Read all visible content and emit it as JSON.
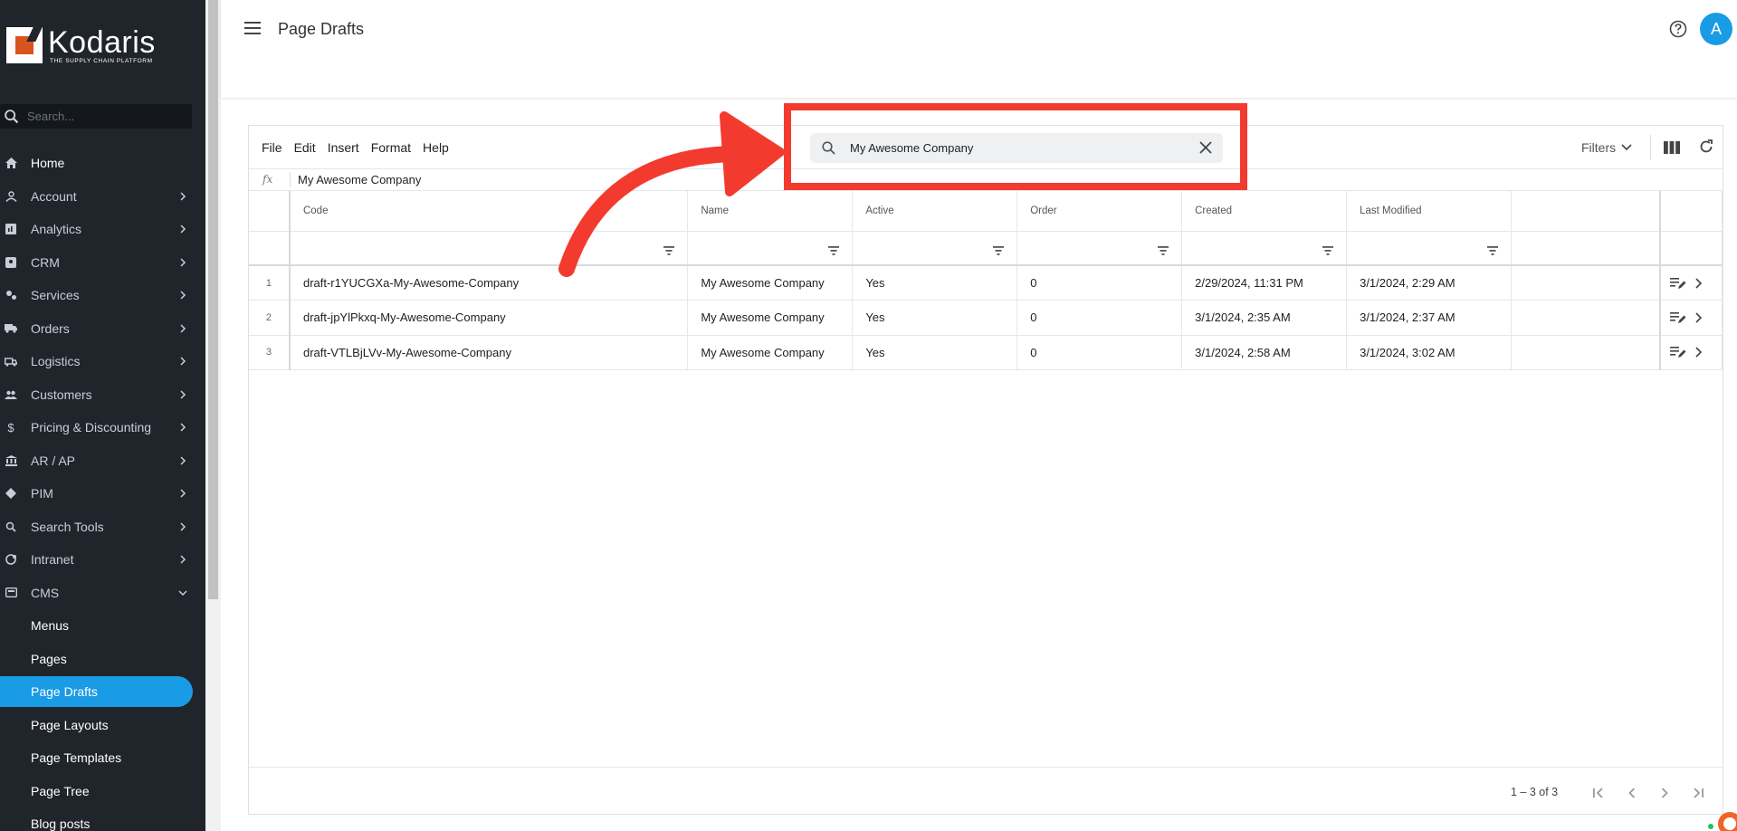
{
  "brand": {
    "name": "Kodaris",
    "tagline": "THE SUPPLY CHAIN PLATFORM"
  },
  "sidebar": {
    "search_placeholder": "Search...",
    "items": [
      {
        "label": "Home",
        "icon": "home-icon",
        "expandable": false
      },
      {
        "label": "Account",
        "icon": "account-icon",
        "expandable": true
      },
      {
        "label": "Analytics",
        "icon": "analytics-icon",
        "expandable": true
      },
      {
        "label": "CRM",
        "icon": "crm-icon",
        "expandable": true
      },
      {
        "label": "Services",
        "icon": "services-icon",
        "expandable": true
      },
      {
        "label": "Orders",
        "icon": "truck-icon",
        "expandable": true
      },
      {
        "label": "Logistics",
        "icon": "logistics-icon",
        "expandable": true
      },
      {
        "label": "Customers",
        "icon": "customers-icon",
        "expandable": true
      },
      {
        "label": "Pricing & Discounting",
        "icon": "dollar-icon",
        "expandable": true
      },
      {
        "label": "AR / AP",
        "icon": "bank-icon",
        "expandable": true
      },
      {
        "label": "PIM",
        "icon": "tag-icon",
        "expandable": true
      },
      {
        "label": "Search Tools",
        "icon": "search-tools-icon",
        "expandable": true
      },
      {
        "label": "Intranet",
        "icon": "intranet-icon",
        "expandable": true
      },
      {
        "label": "CMS",
        "icon": "cms-icon",
        "expandable": true,
        "expanded": true
      }
    ],
    "cms_children": [
      {
        "label": "Menus",
        "active": false
      },
      {
        "label": "Pages",
        "active": false
      },
      {
        "label": "Page Drafts",
        "active": true
      },
      {
        "label": "Page Layouts",
        "active": false
      },
      {
        "label": "Page Templates",
        "active": false
      },
      {
        "label": "Page Tree",
        "active": false
      },
      {
        "label": "Blog posts",
        "active": false
      }
    ]
  },
  "header": {
    "title": "Page Drafts",
    "avatar_letter": "A"
  },
  "toolbar": {
    "menu": [
      "File",
      "Edit",
      "Insert",
      "Format",
      "Help"
    ],
    "search_value": "My Awesome Company",
    "filters_label": "Filters"
  },
  "formula": {
    "fx": "fx",
    "value": "My Awesome Company"
  },
  "table": {
    "columns": [
      "Code",
      "Name",
      "Active",
      "Order",
      "Created",
      "Last Modified"
    ],
    "rows": [
      {
        "n": "1",
        "code": "draft-r1YUCGXa-My-Awesome-Company",
        "name": "My Awesome Company",
        "active": "Yes",
        "order": "0",
        "created": "2/29/2024, 11:31 PM",
        "modified": "3/1/2024, 2:29 AM"
      },
      {
        "n": "2",
        "code": "draft-jpYlPkxq-My-Awesome-Company",
        "name": "My Awesome Company",
        "active": "Yes",
        "order": "0",
        "created": "3/1/2024, 2:35 AM",
        "modified": "3/1/2024, 2:37 AM"
      },
      {
        "n": "3",
        "code": "draft-VTLBjLVv-My-Awesome-Company",
        "name": "My Awesome Company",
        "active": "Yes",
        "order": "0",
        "created": "3/1/2024, 2:58 AM",
        "modified": "3/1/2024, 3:02 AM"
      }
    ]
  },
  "pagination": {
    "range": "1 – 3 of 3"
  },
  "colors": {
    "sidebar_bg": "#20252c",
    "accent": "#1a9be6",
    "annotation": "#f23b2e",
    "brand_orange": "#d9531e"
  }
}
